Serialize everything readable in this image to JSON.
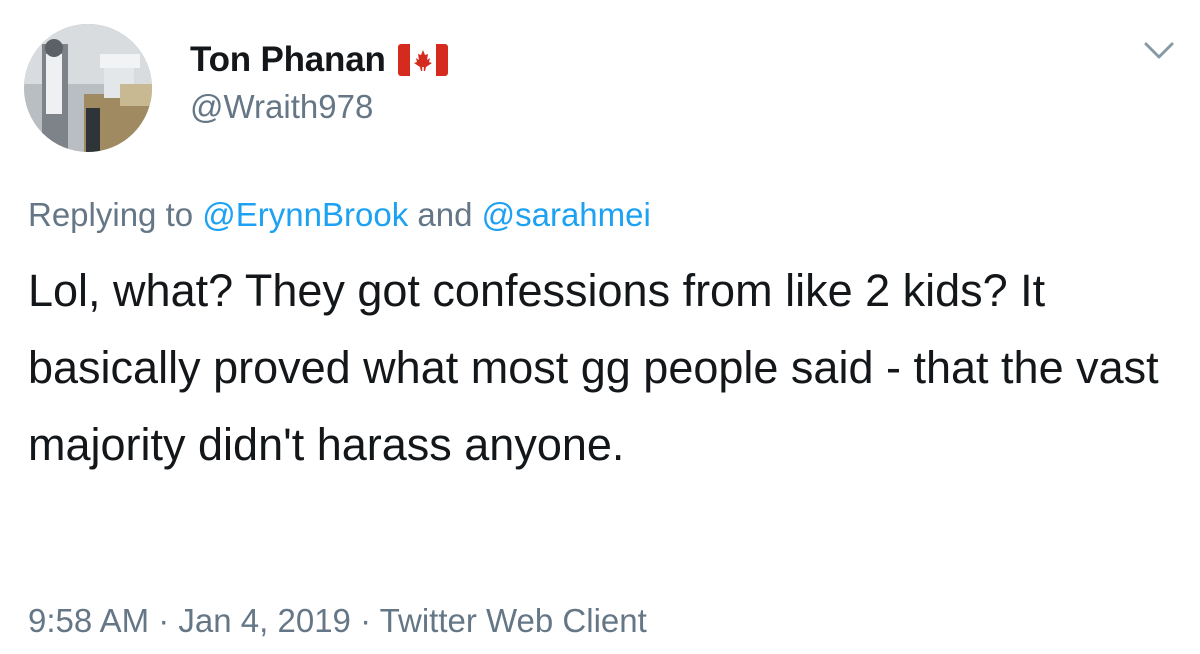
{
  "author": {
    "display_name": "Ton Phanan",
    "flag_icon": "canada-flag-icon",
    "handle": "@Wraith978"
  },
  "reply": {
    "prefix": "Replying to",
    "mentions": [
      "@ErynnBrook",
      "@sarahmei"
    ],
    "joiner": "and"
  },
  "tweet": {
    "text": "Lol, what? They got confessions from like 2 kids? It basically proved what most gg people said - that the vast majority didn't harass anyone."
  },
  "meta": {
    "time": "9:58 AM",
    "separator": "·",
    "date": "Jan 4, 2019",
    "client": "Twitter Web Client"
  },
  "colors": {
    "text": "#14171a",
    "secondary": "#657786",
    "link": "#1da1f2",
    "flag_red": "#d52b1e"
  }
}
